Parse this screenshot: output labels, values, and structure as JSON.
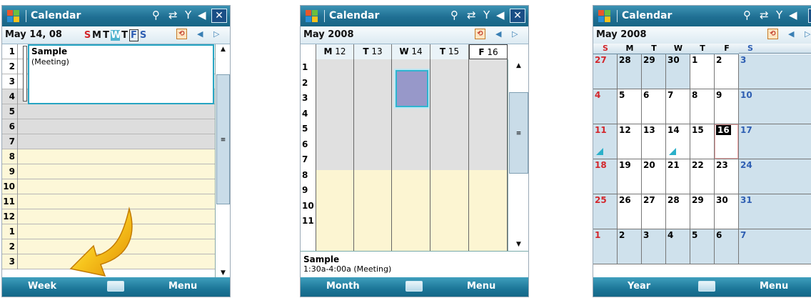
{
  "app": {
    "title": "Calendar",
    "close_label": "✕"
  },
  "day_view": {
    "date": "May 14, 08",
    "week_letters": [
      "S",
      "M",
      "T",
      "W",
      "T",
      "F",
      "S"
    ],
    "hours": [
      "1",
      "2",
      "3",
      "4",
      "5",
      "6",
      "7",
      "8",
      "9",
      "10",
      "11",
      "12",
      "1",
      "2",
      "3"
    ],
    "appointment": {
      "title": "Sample",
      "type": "(Meeting)"
    },
    "softkeys": {
      "left": "Week",
      "right": "Menu"
    }
  },
  "week_view": {
    "month": "May 2008",
    "days": [
      {
        "dow": "M",
        "num": "12"
      },
      {
        "dow": "T",
        "num": "13"
      },
      {
        "dow": "W",
        "num": "14"
      },
      {
        "dow": "T",
        "num": "15"
      },
      {
        "dow": "F",
        "num": "16"
      }
    ],
    "hours": [
      "1",
      "2",
      "3",
      "4",
      "5",
      "6",
      "7",
      "8",
      "9",
      "10",
      "11"
    ],
    "summary": {
      "title": "Sample",
      "detail": "1:30a-4:00a (Meeting)"
    },
    "softkeys": {
      "left": "Month",
      "right": "Menu"
    }
  },
  "month_view": {
    "month": "May 2008",
    "dow": [
      "S",
      "M",
      "T",
      "W",
      "T",
      "F",
      "S"
    ],
    "weeks": [
      [
        "27",
        "28",
        "29",
        "30",
        "1",
        "2",
        "3"
      ],
      [
        "4",
        "5",
        "6",
        "7",
        "8",
        "9",
        "10"
      ],
      [
        "11",
        "12",
        "13",
        "14",
        "15",
        "16",
        "17"
      ],
      [
        "18",
        "19",
        "20",
        "21",
        "22",
        "23",
        "24"
      ],
      [
        "25",
        "26",
        "27",
        "28",
        "29",
        "30",
        "31"
      ],
      [
        "1",
        "2",
        "3",
        "4",
        "5",
        "6",
        "7"
      ]
    ],
    "today": "16",
    "softkeys": {
      "left": "Year",
      "right": "Menu"
    }
  },
  "colors": {
    "title_bar": "#1f6f93",
    "sunday": "#d3262b",
    "saturday": "#2f5fb3",
    "event": "#9798c9",
    "accent": "#2ab0c9"
  },
  "icons": [
    "windows-start-icon",
    "signal-icon",
    "connectivity-icon",
    "antenna-icon",
    "volume-icon",
    "close-icon",
    "today-jump-icon",
    "keyboard-icon",
    "pointer-arrow-icon"
  ]
}
